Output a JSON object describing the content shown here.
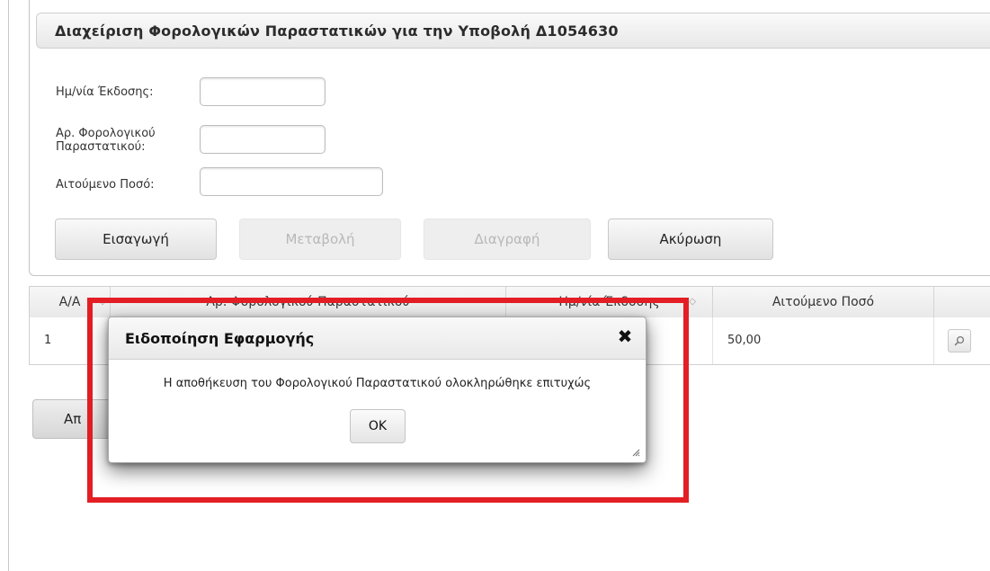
{
  "panel": {
    "title": "Διαχείριση Φορολογικών Παραστατικών για την Υποβολή Δ1054630"
  },
  "form": {
    "date_label": "Ημ/νία Έκδοσης:",
    "date_value": "",
    "doc_no_label_line1": "Αρ. Φορολογικού",
    "doc_no_label_line2": "Παραστατικού:",
    "doc_no_value": "",
    "amount_label": "Αιτούμενο Ποσό:",
    "amount_value": ""
  },
  "buttons": {
    "insert": "Εισαγωγή",
    "modify": "Μεταβολή",
    "delete": "Διαγραφή",
    "cancel": "Ακύρωση",
    "save_partial": "Απ"
  },
  "table": {
    "headers": {
      "aa": "Α/Α",
      "doc_no": "Αρ. Φορολογικού Παραστατικού",
      "date": "Ημ/νία Έκδοσης",
      "amount": "Αιτούμενο Ποσό"
    },
    "rows": [
      {
        "aa": "1",
        "doc_no": "",
        "date": "",
        "amount": "50,00"
      }
    ]
  },
  "dialog": {
    "title": "Ειδοποίηση Εφαρμογής",
    "message": "Η αποθήκευση του Φορολογικού Παραστατικού ολοκληρώθηκε επιτυχώς",
    "ok": "OK"
  },
  "colors": {
    "highlight": "#e31e24"
  },
  "icons": {
    "close": "close-icon",
    "view": "magnifier-icon",
    "sort": "sort-icon",
    "resize": "resize-grip-icon"
  }
}
